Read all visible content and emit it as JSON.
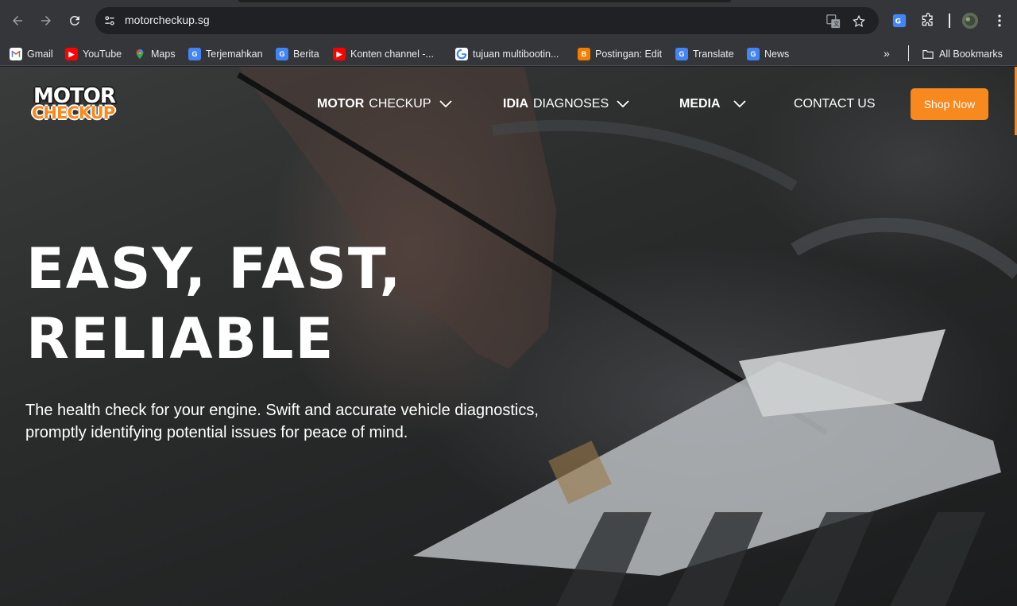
{
  "browser": {
    "url": "motorcheckup.sg",
    "bookmarks": [
      {
        "label": "Gmail",
        "icon": "gmail-icon"
      },
      {
        "label": "YouTube",
        "icon": "youtube-icon"
      },
      {
        "label": "Maps",
        "icon": "maps-icon"
      },
      {
        "label": "Terjemahkan",
        "icon": "translate-icon"
      },
      {
        "label": "Berita",
        "icon": "news-icon"
      },
      {
        "label": "Konten channel -...",
        "icon": "youtube-icon"
      },
      {
        "label": "tujuan multibootin...",
        "icon": "google-icon"
      },
      {
        "label": "Postingan: Edit",
        "icon": "blogger-icon"
      },
      {
        "label": "Translate",
        "icon": "translate-icon"
      },
      {
        "label": "News",
        "icon": "news-icon"
      }
    ],
    "more_label": "»",
    "all_bookmarks": "All Bookmarks"
  },
  "site": {
    "logo_line1": "MOTOR",
    "logo_line2": "CHECKUP",
    "nav": [
      {
        "bold": "MOTOR",
        "rest": "CHECKUP"
      },
      {
        "bold": "IDIA",
        "rest": "DIAGNOSES"
      },
      {
        "bold": "MEDIA",
        "rest": ""
      },
      {
        "bold": "",
        "rest": "CONTACT US"
      }
    ],
    "shop_label": "Shop Now",
    "hero": {
      "title_line1": "EASY, FAST,",
      "title_line2": "RELIABLE",
      "subtitle": "The health check for your engine. Swift and accurate vehicle diagnostics, promptly identifying potential issues for peace of mind."
    },
    "colors": {
      "accent": "#f7891e"
    }
  }
}
